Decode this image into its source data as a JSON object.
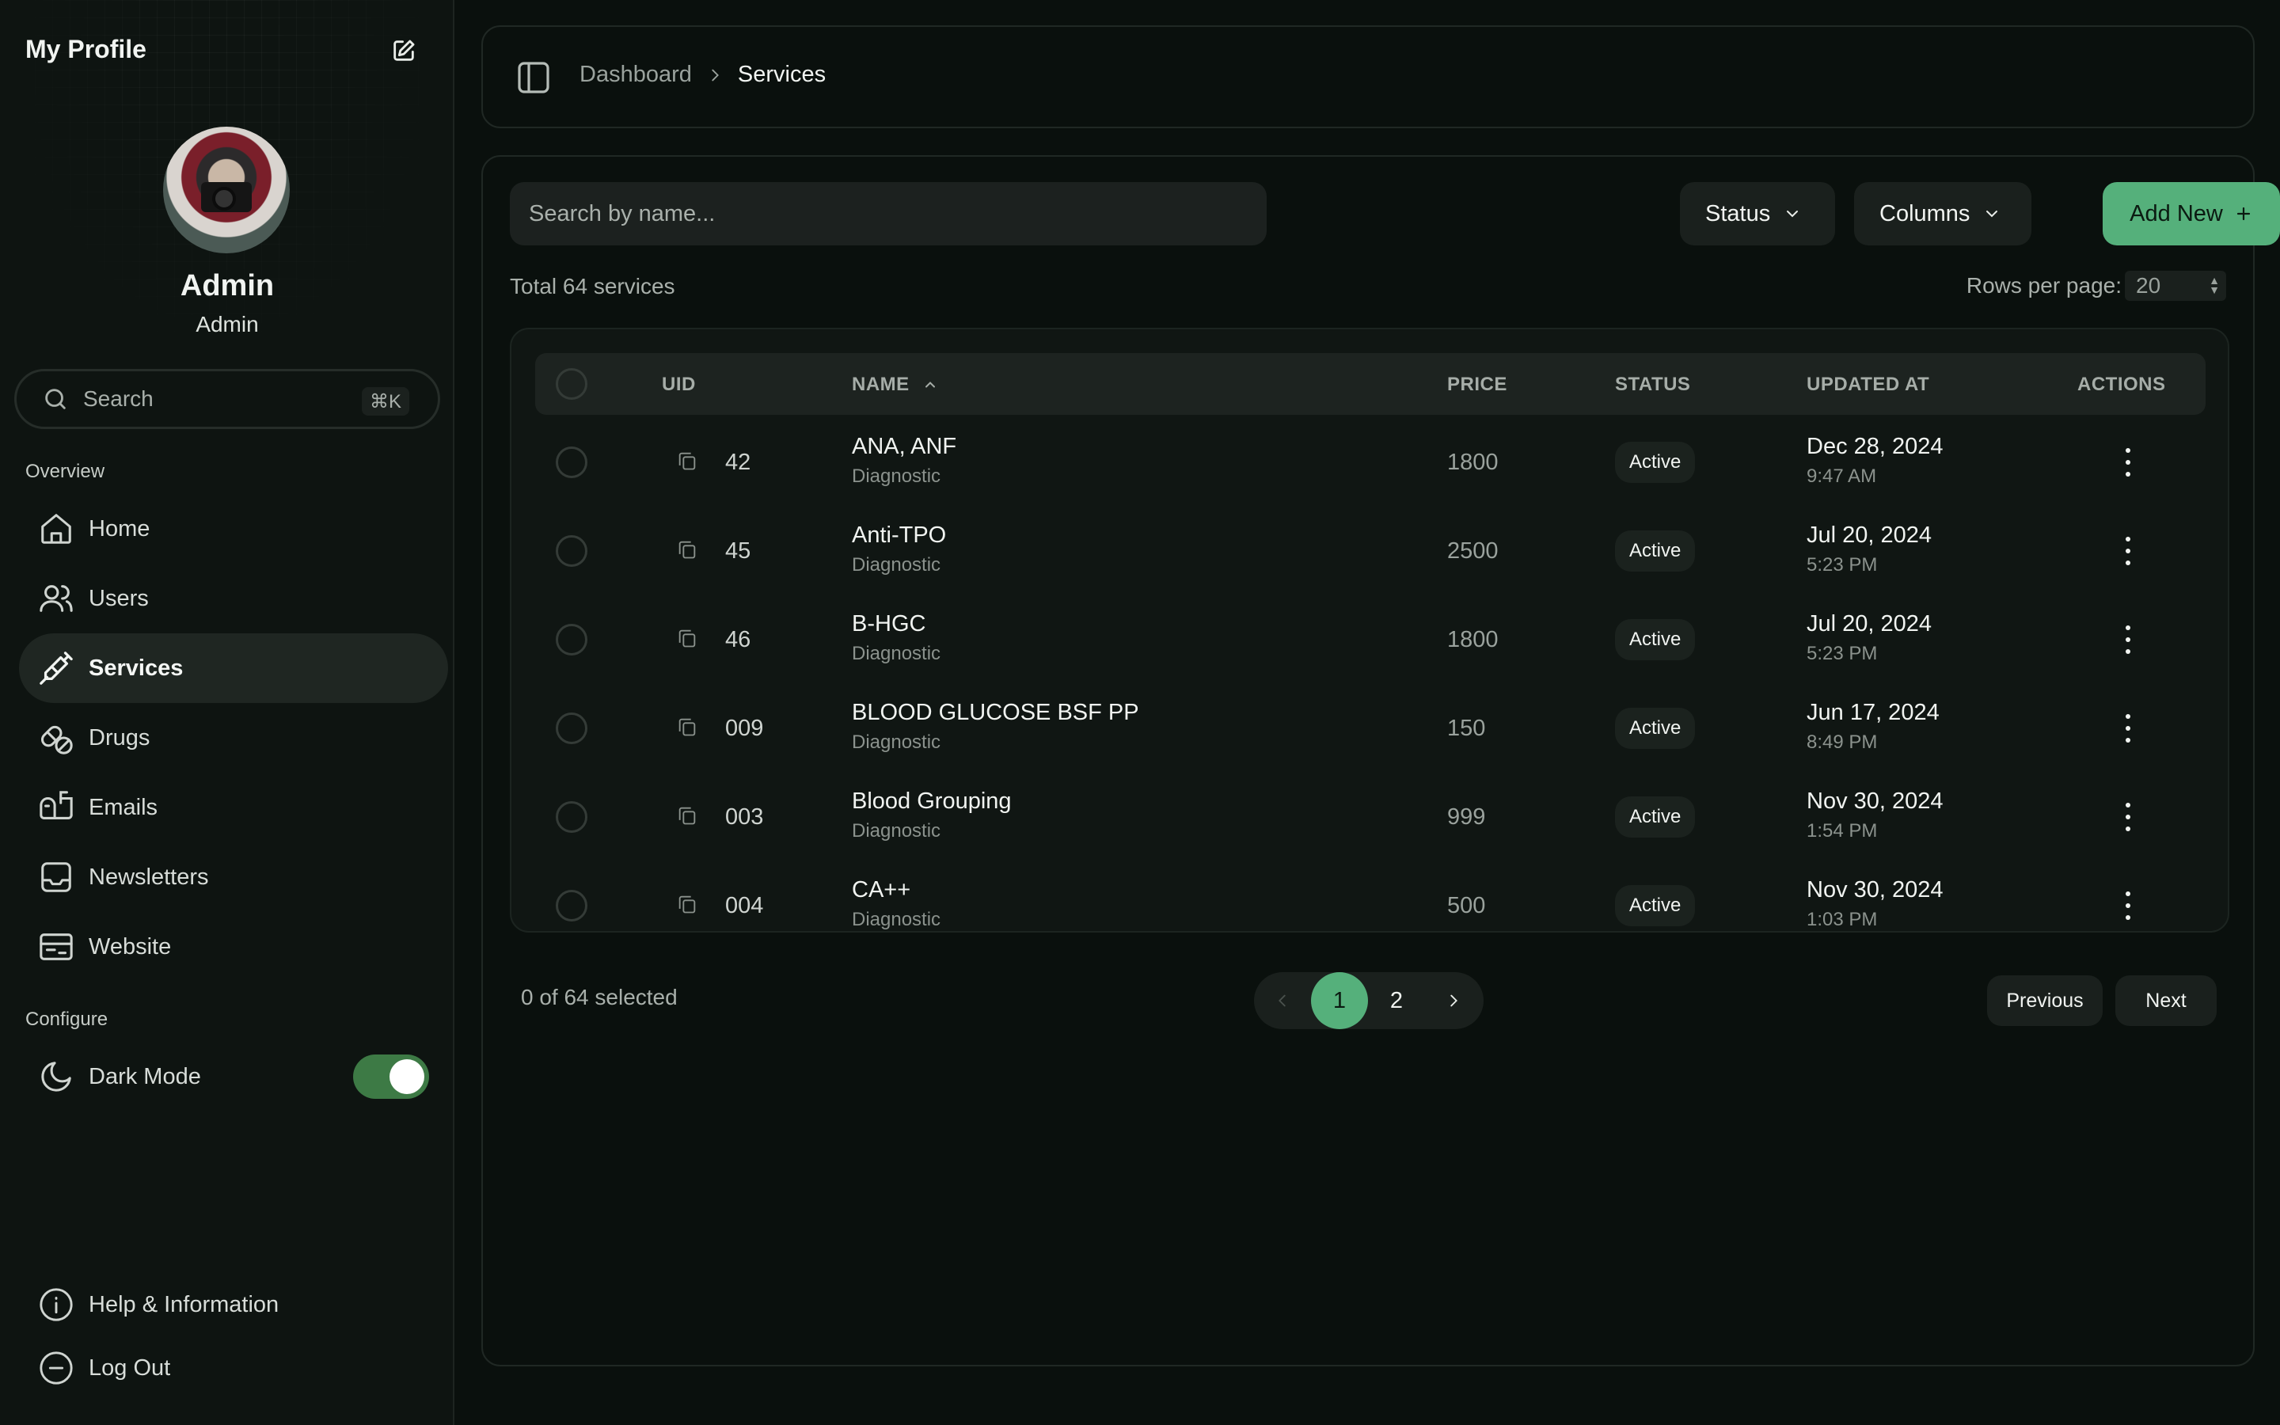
{
  "sidebar": {
    "title": "My Profile",
    "user": {
      "name": "Admin",
      "role": "Admin"
    },
    "search": {
      "placeholder": "Search",
      "shortcut": "⌘K"
    },
    "sections": {
      "overview": "Overview",
      "configure": "Configure"
    },
    "items": [
      {
        "label": "Home",
        "icon": "home-icon"
      },
      {
        "label": "Users",
        "icon": "users-icon"
      },
      {
        "label": "Services",
        "icon": "syringe-icon",
        "active": true
      },
      {
        "label": "Drugs",
        "icon": "pills-icon"
      },
      {
        "label": "Emails",
        "icon": "mailbox-icon"
      },
      {
        "label": "Newsletters",
        "icon": "inbox-icon"
      },
      {
        "label": "Website",
        "icon": "browser-icon"
      }
    ],
    "dark_mode": {
      "label": "Dark Mode",
      "enabled": true
    },
    "footer": {
      "help": "Help & Information",
      "logout": "Log Out"
    }
  },
  "breadcrumb": {
    "parent": "Dashboard",
    "current": "Services"
  },
  "toolbar": {
    "search_placeholder": "Search by name...",
    "status_label": "Status",
    "columns_label": "Columns",
    "add_label": "Add New"
  },
  "summary": {
    "total": "Total 64 services",
    "rows_per_page_label": "Rows per page:",
    "rows_per_page_value": "20"
  },
  "table": {
    "headers": {
      "uid": "UID",
      "name": "NAME",
      "price": "PRICE",
      "status": "STATUS",
      "updated": "UPDATED AT",
      "actions": "ACTIONS"
    },
    "rows": [
      {
        "uid": "42",
        "name": "ANA, ANF",
        "category": "Diagnostic",
        "price": "1800",
        "status": "Active",
        "date": "Dec 28, 2024",
        "time": "9:47 AM"
      },
      {
        "uid": "45",
        "name": "Anti-TPO",
        "category": "Diagnostic",
        "price": "2500",
        "status": "Active",
        "date": "Jul 20, 2024",
        "time": "5:23 PM"
      },
      {
        "uid": "46",
        "name": "B-HGC",
        "category": "Diagnostic",
        "price": "1800",
        "status": "Active",
        "date": "Jul 20, 2024",
        "time": "5:23 PM"
      },
      {
        "uid": "009",
        "name": "BLOOD GLUCOSE BSF PP",
        "category": "Diagnostic",
        "price": "150",
        "status": "Active",
        "date": "Jun 17, 2024",
        "time": "8:49 PM"
      },
      {
        "uid": "003",
        "name": "Blood Grouping",
        "category": "Diagnostic",
        "price": "999",
        "status": "Active",
        "date": "Nov 30, 2024",
        "time": "1:54 PM"
      },
      {
        "uid": "004",
        "name": "CA++",
        "category": "Diagnostic",
        "price": "500",
        "status": "Active",
        "date": "Nov 30, 2024",
        "time": "1:03 PM"
      }
    ]
  },
  "footer": {
    "selected": "0 of 64 selected",
    "pages": [
      "1",
      "2"
    ],
    "current_page": "1",
    "previous": "Previous",
    "next": "Next"
  },
  "colors": {
    "accent": "#55b07b",
    "background": "#0a100d",
    "surface": "#1a201d"
  }
}
